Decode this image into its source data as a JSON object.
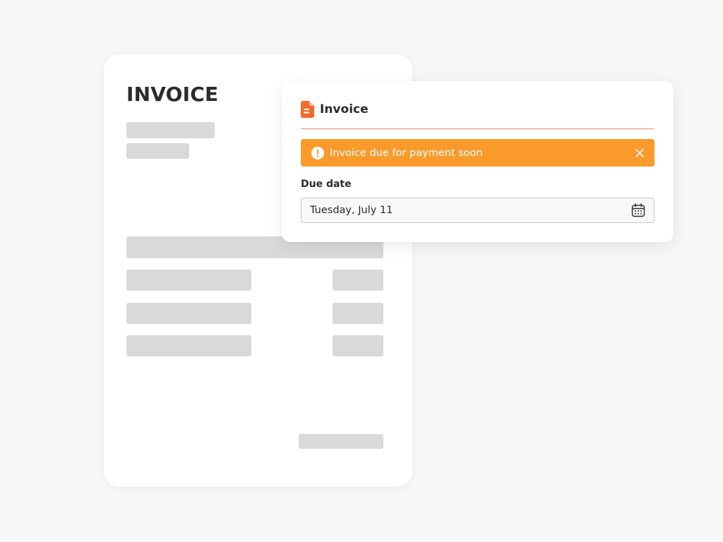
{
  "document": {
    "title": "INVOICE"
  },
  "panel": {
    "title": "Invoice",
    "icon": "document-icon",
    "accent_color": "#f26b2a",
    "alert": {
      "message": "Invoice due for payment soon",
      "icon": "exclamation-circle-icon",
      "close_icon": "close-icon",
      "background_color": "#fa9a2a"
    },
    "due_date": {
      "label": "Due date",
      "value": "Tuesday, July 11",
      "icon": "calendar-icon"
    }
  }
}
